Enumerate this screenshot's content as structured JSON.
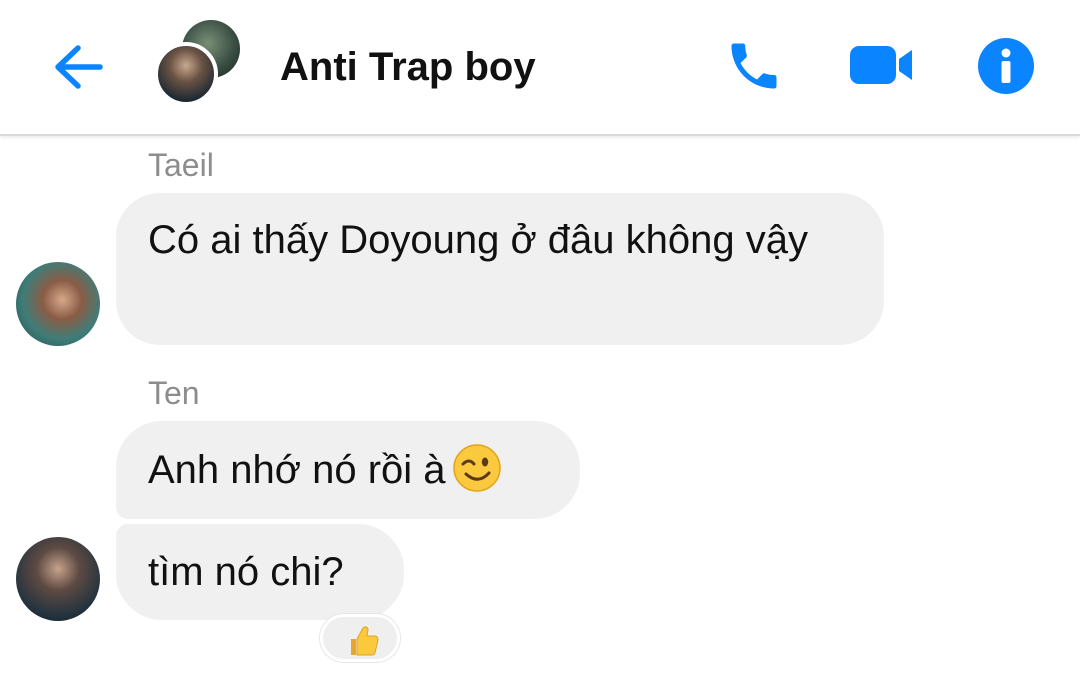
{
  "header": {
    "title": "Anti Trap boy",
    "accent_color": "#0a84ff",
    "icons": [
      "back-arrow-icon",
      "phone-icon",
      "video-camera-icon",
      "info-icon"
    ]
  },
  "messages": [
    {
      "sender": "Taeil",
      "bubbles": [
        {
          "text": "Có ai thấy Doyoung ở đâu không vậy"
        }
      ]
    },
    {
      "sender": "Ten",
      "bubbles": [
        {
          "text": "Anh nhớ nó rồi à",
          "emoji": "wink-emoji"
        },
        {
          "text": "tìm nó chi?",
          "reaction": "thumbs-up-emoji"
        }
      ]
    }
  ]
}
